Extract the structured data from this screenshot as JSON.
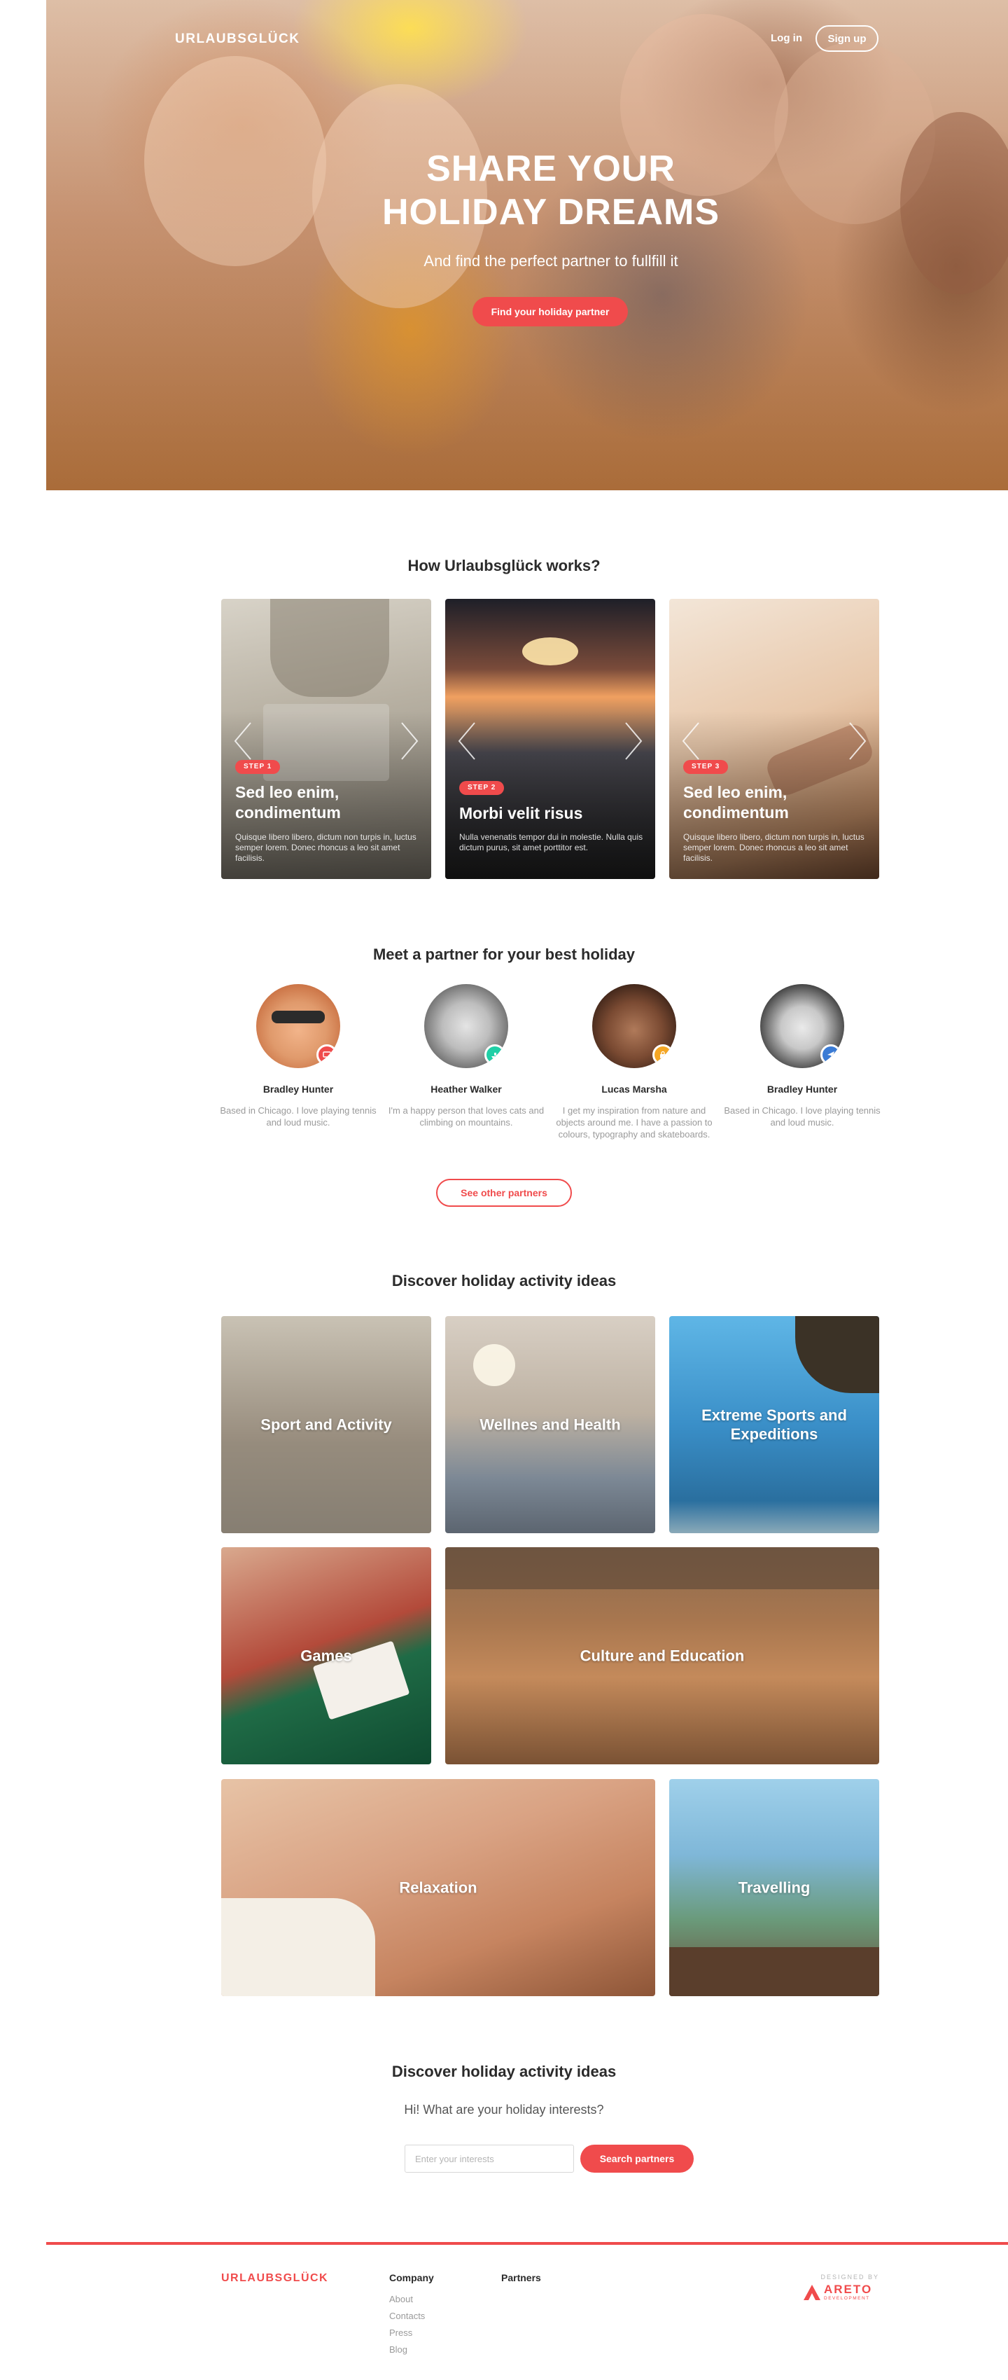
{
  "brand": {
    "name": "URLAUBSGLÜCK",
    "accent": "#f04b4c"
  },
  "nav": {
    "login": "Log in",
    "signup": "Sign up"
  },
  "hero": {
    "title_line1": "SHARE YOUR",
    "title_line2": "HOLIDAY DREAMS",
    "subtitle": "And find the perfect partner to fullfill it",
    "cta": "Find your holiday partner"
  },
  "how": {
    "title": "How Urlaubsglück works?",
    "steps": [
      {
        "badge": "STEP 1",
        "title": "Sed leo enim, condimentum",
        "text": "Quisque libero libero, dictum non turpis in, luctus semper lorem. Donec rhoncus a leo sit amet facilisis."
      },
      {
        "badge": "STEP 2",
        "title": "Morbi velit risus",
        "text": "Nulla venenatis tempor dui in molestie. Nulla quis dictum purus, sit amet porttitor est."
      },
      {
        "badge": "STEP 3",
        "title": "Sed leo enim, condimentum",
        "text": "Quisque libero libero, dictum non turpis in, luctus semper lorem. Donec rhoncus a leo sit amet facilisis."
      }
    ]
  },
  "partners": {
    "title": "Meet a partner for your best holiday",
    "items": [
      {
        "name": "Bradley Hunter",
        "bio": "Based in Chicago. I love playing tennis and loud music.",
        "badge_color": "#f04b4c",
        "badge_icon": "tv-icon"
      },
      {
        "name": "Heather Walker",
        "bio": "I'm a happy person that loves cats and climbing on mountains.",
        "badge_color": "#1fcfa6",
        "badge_icon": "ship-icon"
      },
      {
        "name": "Lucas Marsha",
        "bio": "I get my inspiration from nature and objects around me. I have a passion to colours, typography and skateboards.",
        "badge_color": "#f5a623",
        "badge_icon": "lock-icon"
      },
      {
        "name": "Bradley Hunter",
        "bio": "Based in Chicago. I love playing tennis and loud music.",
        "badge_color": "#3a7bd5",
        "badge_icon": "plane-icon"
      }
    ],
    "more": "See other partners"
  },
  "activities": {
    "title": "Discover holiday activity ideas",
    "tiles": [
      "Sport and Activity",
      "Wellnes and Health",
      "Extreme Sports and Expeditions",
      "Games",
      "Culture and Education",
      "Relaxation",
      "Travelling"
    ]
  },
  "search": {
    "title": "Discover holiday activity ideas",
    "question": "Hi! What are your holiday interests?",
    "placeholder": "Enter your interests",
    "button": "Search partners"
  },
  "footer": {
    "logo": "URLAUBSGLÜCK",
    "company_heading": "Company",
    "company_links": [
      "About",
      "Contacts",
      "Press",
      "Blog"
    ],
    "partners_heading": "Partners",
    "designed_by": "DESIGNED BY",
    "designer": "ARETO",
    "designer_sub": "DEVELOPMENT"
  }
}
